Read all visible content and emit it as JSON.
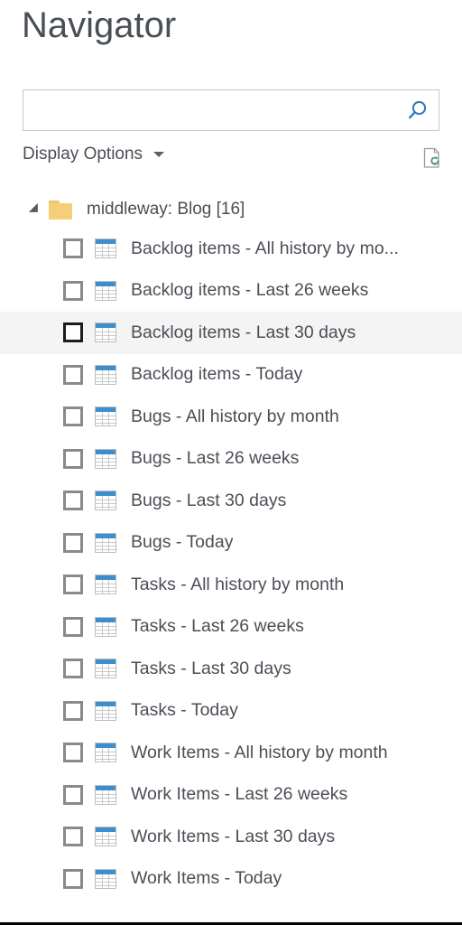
{
  "window": {
    "title": "Navigator"
  },
  "search": {
    "value": "",
    "placeholder": "",
    "icon": "search-icon"
  },
  "toolbar": {
    "display_options_label": "Display Options",
    "display_options_caret": "chevron-down-icon",
    "refresh_preview_icon": "document-refresh-icon"
  },
  "colors": {
    "accent_blue": "#3e8ecc",
    "search_icon_blue": "#2e7cc4",
    "folder_gold": "#f5ce78",
    "text_gray": "#4a4f56",
    "selected_row_bg": "#f4f4f4",
    "refresh_green": "#4a9b77"
  },
  "tree": {
    "group": {
      "label": "middleway: Blog [16]",
      "expanded": true,
      "icon": "folder-icon",
      "expander_icon": "triangle-expanded-icon"
    },
    "items": [
      {
        "label": "Backlog items - All history by mo...",
        "checked": false,
        "selected": false,
        "icon": "table-icon"
      },
      {
        "label": "Backlog items - Last 26 weeks",
        "checked": false,
        "selected": false,
        "icon": "table-icon"
      },
      {
        "label": "Backlog items - Last 30 days",
        "checked": false,
        "selected": true,
        "icon": "table-icon"
      },
      {
        "label": "Backlog items - Today",
        "checked": false,
        "selected": false,
        "icon": "table-icon"
      },
      {
        "label": "Bugs - All history by month",
        "checked": false,
        "selected": false,
        "icon": "table-icon"
      },
      {
        "label": "Bugs - Last 26 weeks",
        "checked": false,
        "selected": false,
        "icon": "table-icon"
      },
      {
        "label": "Bugs - Last 30 days",
        "checked": false,
        "selected": false,
        "icon": "table-icon"
      },
      {
        "label": "Bugs - Today",
        "checked": false,
        "selected": false,
        "icon": "table-icon"
      },
      {
        "label": "Tasks - All history by month",
        "checked": false,
        "selected": false,
        "icon": "table-icon"
      },
      {
        "label": "Tasks - Last 26 weeks",
        "checked": false,
        "selected": false,
        "icon": "table-icon"
      },
      {
        "label": "Tasks - Last 30 days",
        "checked": false,
        "selected": false,
        "icon": "table-icon"
      },
      {
        "label": "Tasks - Today",
        "checked": false,
        "selected": false,
        "icon": "table-icon"
      },
      {
        "label": "Work Items - All history by month",
        "checked": false,
        "selected": false,
        "icon": "table-icon"
      },
      {
        "label": "Work Items - Last 26 weeks",
        "checked": false,
        "selected": false,
        "icon": "table-icon"
      },
      {
        "label": "Work Items - Last 30 days",
        "checked": false,
        "selected": false,
        "icon": "table-icon"
      },
      {
        "label": "Work Items - Today",
        "checked": false,
        "selected": false,
        "icon": "table-icon"
      }
    ]
  }
}
